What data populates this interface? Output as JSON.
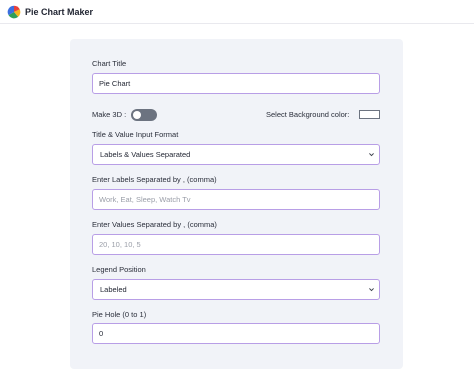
{
  "app": {
    "title": "Pie Chart Maker",
    "icon": "pie-chart-logo"
  },
  "form": {
    "chart_title": {
      "label": "Chart Title",
      "value": "Pie Chart"
    },
    "make_3d": {
      "label": "Make 3D :",
      "enabled": false
    },
    "background_color": {
      "label": "Select Background color:",
      "value": "#ffffff"
    },
    "input_format": {
      "label": "Title & Value Input Format",
      "selected": "Labels & Values Separated"
    },
    "labels": {
      "label": "Enter Labels Separated by , (comma)",
      "value": "",
      "placeholder": "Work, Eat, Sleep, Watch Tv"
    },
    "values": {
      "label": "Enter Values Separated by , (comma)",
      "value": "",
      "placeholder": "20, 10, 10, 5"
    },
    "legend_position": {
      "label": "Legend Position",
      "selected": "Labeled"
    },
    "pie_hole": {
      "label": "Pie Hole (0 to 1)",
      "value": "0"
    }
  },
  "colors": {
    "accent_border": "#b89ee6",
    "panel_bg": "#f1f3f8",
    "toggle_off": "#6c7380"
  }
}
